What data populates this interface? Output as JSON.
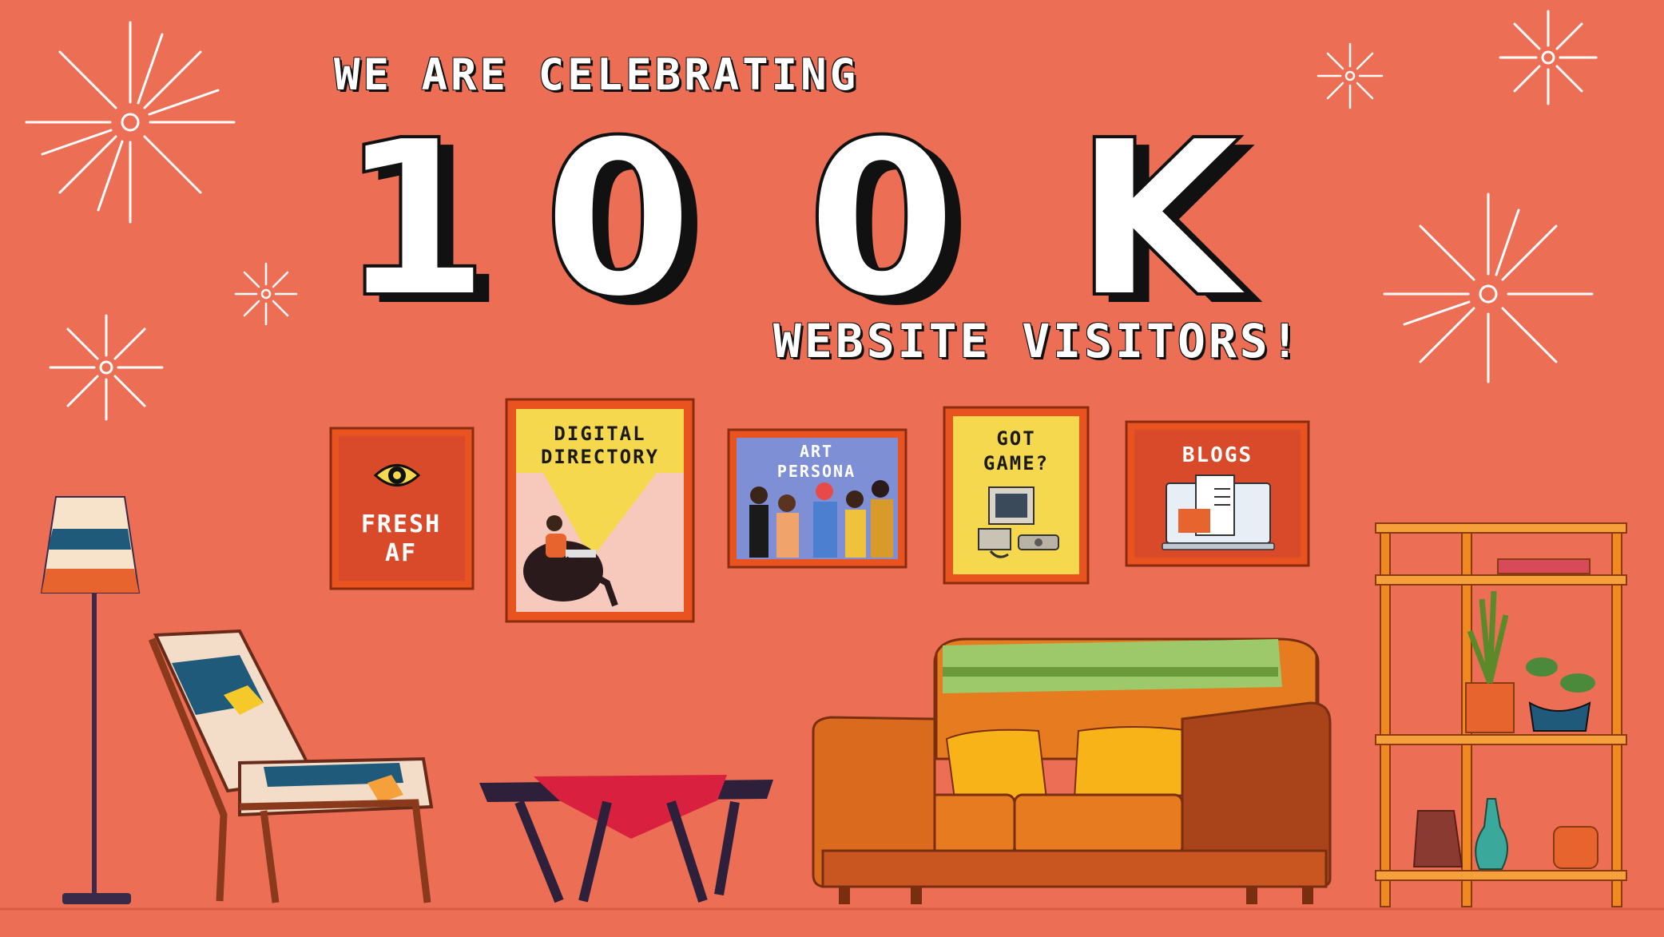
{
  "headline": {
    "top": "WE ARE CELEBRATING",
    "digits": [
      "1",
      "0",
      "0",
      "K"
    ],
    "bottom": "WEBSITE VISITORS!"
  },
  "frames": {
    "fresh_line1": "FRESH",
    "fresh_line2": "AF",
    "directory_line1": "DIGITAL",
    "directory_line2": "DIRECTORY",
    "art_line1": "ART",
    "art_line2": "PERSONA",
    "game_line1": "GOT",
    "game_line2": "GAME?",
    "blogs": "BLOGS"
  },
  "colors": {
    "background": "#ec6f55",
    "frame_orange": "#e8531f",
    "frame_red": "#d84a2a",
    "yellow": "#f5d84e",
    "blue_poster": "#7f8fd6",
    "sofa": "#e67b1f",
    "cushion": "#f8b319",
    "throw": "#9dc96a"
  },
  "icons": [
    "firework-icon",
    "eye-icon",
    "retro-computer-icon",
    "laptop-blog-icon",
    "lamp-icon"
  ]
}
